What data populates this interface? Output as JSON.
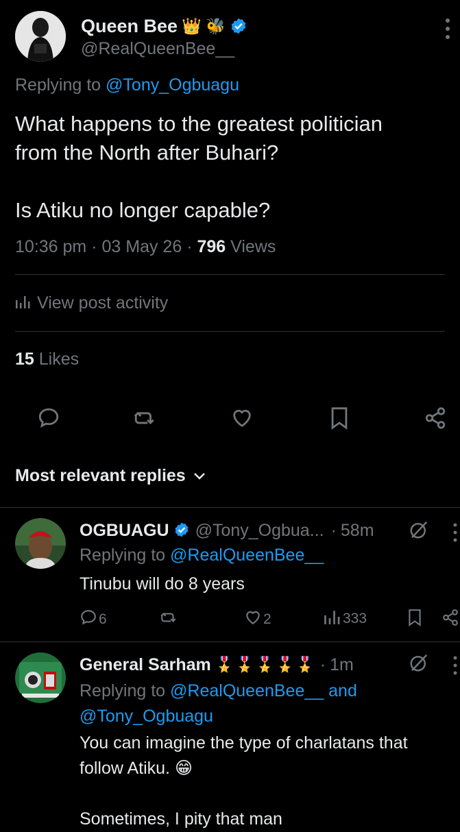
{
  "tweet": {
    "author_name": "Queen Bee",
    "author_emoji": "👑 🐝",
    "handle": "@RealQueenBee__",
    "replying_prefix": "Replying to",
    "replying_to": "@Tony_Ogbuagu",
    "text_line1": "What happens to the greatest politician",
    "text_line2": "from the North after Buhari?",
    "text_line3": "Is Atiku no longer capable?",
    "time": "10:36 pm",
    "date": "03 May 26",
    "views_count": "796",
    "views_label": "Views",
    "activity_label": "View post activity",
    "likes_count": "15",
    "likes_label": "Likes"
  },
  "replies_filter": "Most relevant replies",
  "replies": [
    {
      "name": "OGBUAGU",
      "handle": "@Tony_Ogbua...",
      "time": "58m",
      "replying_prefix": "Replying to",
      "replying_to": "@RealQueenBee__",
      "text": "Tinubu will do 8 years",
      "comments": "6",
      "likes": "2",
      "views": "333"
    },
    {
      "name": "General Sarham",
      "medals": "🎖️🎖️🎖️🎖️🎖️",
      "time": "1m",
      "replying_prefix": "Replying to",
      "replying_to_1": "@RealQueenBee__",
      "replying_and": "and",
      "replying_to_2": "@Tony_Ogbuagu",
      "text_line1": "You can imagine the type of charlatans that",
      "text_line2": "follow Atiku. 😁",
      "text_line3": "Sometimes, I pity that man"
    }
  ],
  "colors": {
    "accent": "#1d9bf0",
    "muted": "#71767b",
    "text": "#e7e9ea",
    "bg": "#000000"
  }
}
